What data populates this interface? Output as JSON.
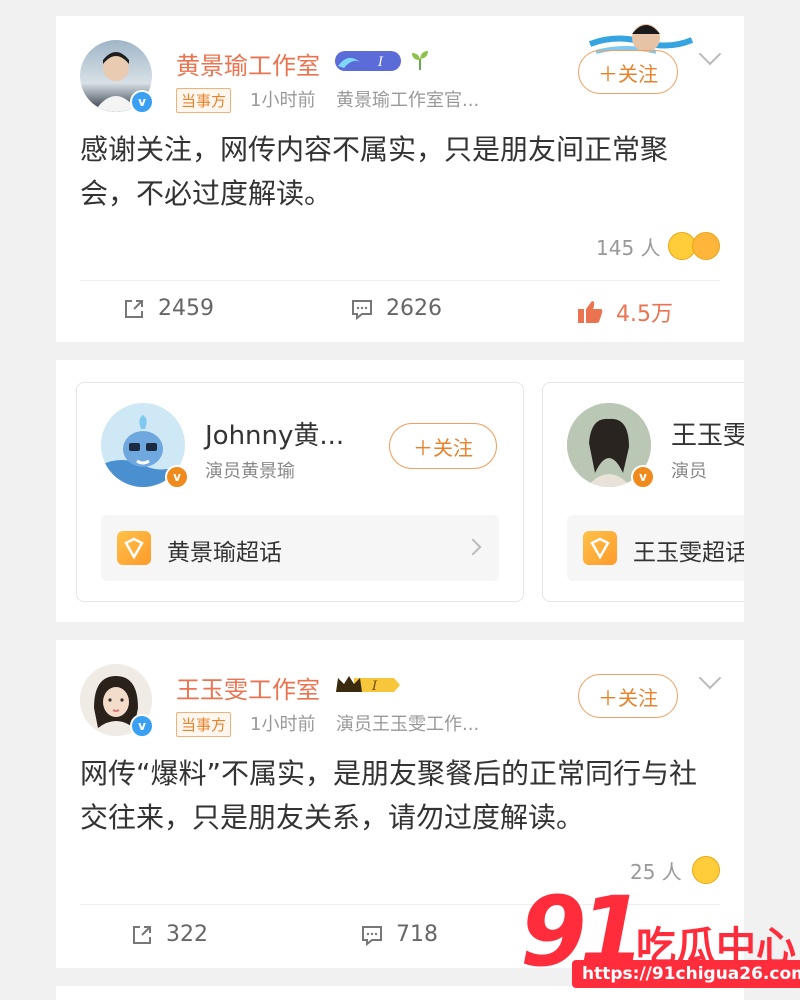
{
  "posts": [
    {
      "author": "黄景瑜工作室",
      "tag": "当事方",
      "time": "1小时前",
      "source": "黄景瑜工作室官...",
      "follow_label": "＋关注",
      "text": "感谢关注，网传内容不属实，只是朋友间正常聚会，不必过度解读。",
      "likers": "145 人",
      "reposts": "2459",
      "comments": "2626",
      "likes": "4.5万"
    },
    {
      "author": "王玉雯工作室",
      "tag": "当事方",
      "time": "1小时前",
      "source": "演员王玉雯工作...",
      "follow_label": "＋关注",
      "text": "网传“爆料”不属实，是朋友聚餐后的正常同行与社交往来，只是朋友关系，请勿过度解读。",
      "likers": "25 人",
      "reposts": "322",
      "comments": "718"
    }
  ],
  "recommendations": [
    {
      "name": "Johnny黄...",
      "subtitle": "演员黄景瑜",
      "follow_label": "＋关注",
      "topic": "黄景瑜超话"
    },
    {
      "name": "王玉雯",
      "subtitle": "演员",
      "topic": "王玉雯超话"
    }
  ],
  "badges": {
    "level_label": "I"
  },
  "watermark": {
    "number": "91",
    "brand": "吃瓜中心",
    "url": "https://91chigua26.com"
  },
  "colors": {
    "accent": "#eb7350",
    "verified_blue": "#3aa0f3",
    "verified_orange": "#f08a1c",
    "watermark_red": "#ff2d3c"
  }
}
